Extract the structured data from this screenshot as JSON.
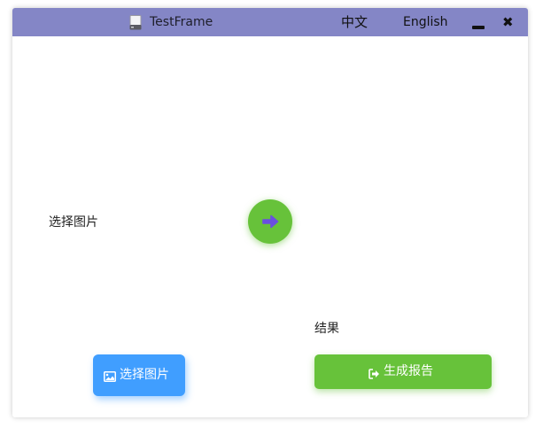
{
  "window": {
    "title": "TestFrame",
    "icons": {
      "app": "drive-icon",
      "minimize": "minimize-icon",
      "close": "close-icon"
    },
    "close_glyph": "✖"
  },
  "language": {
    "chinese_label": "中文",
    "english_label": "English"
  },
  "main": {
    "select_label": "选择图片",
    "next_icon": "arrow-right-icon",
    "result_label": "结果"
  },
  "actions": {
    "select_image_label": "选择图片",
    "select_image_icon": "image-icon",
    "generate_report_label": "生成报告",
    "generate_report_icon": "sign-out-icon"
  },
  "colors": {
    "titlebar": "#8486c6",
    "primary": "#409eff",
    "success": "#67c23a",
    "arrow": "#6a4fe0"
  }
}
